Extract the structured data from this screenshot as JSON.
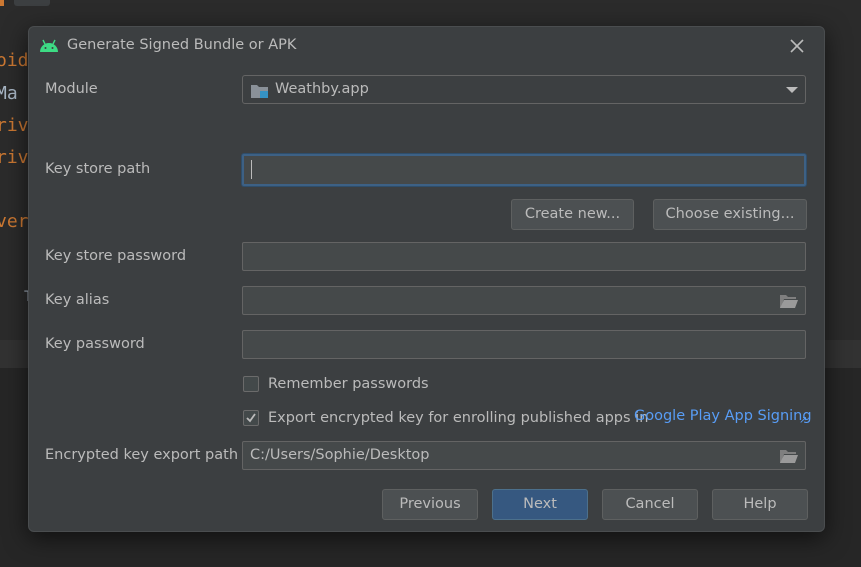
{
  "background": {
    "code_fragments": [
      "oid",
      "Ma",
      "riv",
      "riv",
      "ver",
      "T"
    ],
    "top_dots": "…"
  },
  "dialog": {
    "title": "Generate Signed Bundle or APK",
    "module": {
      "label": "Module",
      "value": "Weathby.app"
    },
    "key_store_path": {
      "label": "Key store path",
      "value": ""
    },
    "create_new_label": "Create new...",
    "choose_existing_label": "Choose existing...",
    "key_store_password": {
      "label": "Key store password",
      "value": ""
    },
    "key_alias": {
      "label": "Key alias",
      "value": ""
    },
    "key_password": {
      "label": "Key password",
      "value": ""
    },
    "remember_passwords": {
      "label": "Remember passwords",
      "checked": false
    },
    "export_encrypted": {
      "label": "Export encrypted key for enrolling published apps in",
      "link": "Google Play App Signing",
      "checked": true
    },
    "encrypted_export_path": {
      "label": "Encrypted key export path",
      "value": "C:/Users/Sophie/Desktop"
    },
    "buttons": {
      "previous": "Previous",
      "next": "Next",
      "cancel": "Cancel",
      "help": "Help"
    }
  },
  "colors": {
    "accent": "#365880",
    "link": "#589df6",
    "android_green": "#3ddc84",
    "focus_border": "#3d6185"
  }
}
